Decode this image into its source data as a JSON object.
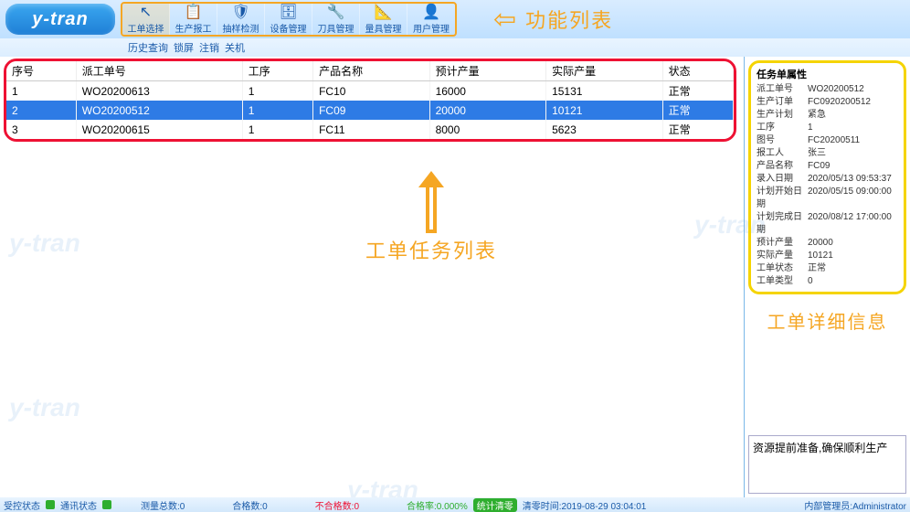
{
  "logo_text": "y-tran",
  "toolbar": [
    {
      "icon": "↖",
      "label": "工单选择"
    },
    {
      "icon": "📋",
      "label": "生产报工"
    },
    {
      "icon": "🛡",
      "label": "抽样检测"
    },
    {
      "icon": "🗄",
      "label": "设备管理"
    },
    {
      "icon": "🔧",
      "label": "刀具管理"
    },
    {
      "icon": "📐",
      "label": "量具管理"
    },
    {
      "icon": "👤",
      "label": "用户管理"
    }
  ],
  "secondary_menu": [
    "历史查询",
    "锁屏",
    "注销",
    "关机"
  ],
  "annotations": {
    "toolbar_label": "功能列表",
    "table_label": "工单任务列表",
    "detail_label": "工单详细信息"
  },
  "table": {
    "headers": [
      "序号",
      "派工单号",
      "工序",
      "产品名称",
      "预计产量",
      "实际产量",
      "状态"
    ],
    "rows": [
      {
        "seq": "1",
        "wo": "WO20200613",
        "op": "1",
        "prod": "FC10",
        "plan": "16000",
        "act": "15131",
        "stat": "正常",
        "selected": false
      },
      {
        "seq": "2",
        "wo": "WO20200512",
        "op": "1",
        "prod": "FC09",
        "plan": "20000",
        "act": "10121",
        "stat": "正常",
        "selected": true
      },
      {
        "seq": "3",
        "wo": "WO20200615",
        "op": "1",
        "prod": "FC11",
        "plan": "8000",
        "act": "5623",
        "stat": "正常",
        "selected": false
      }
    ]
  },
  "detail": {
    "title": "任务单属性",
    "rows": [
      {
        "k": "派工单号",
        "v": "WO20200512"
      },
      {
        "k": "生产订单",
        "v": "FC0920200512"
      },
      {
        "k": "生产计划",
        "v": "紧急"
      },
      {
        "k": "工序",
        "v": "1"
      },
      {
        "k": "图号",
        "v": "FC20200511"
      },
      {
        "k": "报工人",
        "v": "张三"
      },
      {
        "k": "产品名称",
        "v": "FC09"
      },
      {
        "k": "录入日期",
        "v": "2020/05/13 09:53:37"
      },
      {
        "k": "计划开始日期",
        "v": "2020/05/15 09:00:00"
      },
      {
        "k": "计划完成日期",
        "v": "2020/08/12 17:00:00"
      },
      {
        "k": "预计产量",
        "v": "20000"
      },
      {
        "k": "实际产量",
        "v": "10121"
      },
      {
        "k": "工单状态",
        "v": "正常"
      },
      {
        "k": "工单类型",
        "v": "0"
      }
    ]
  },
  "right_note": "资源提前准备,确保顺利生产",
  "status": {
    "recv": "受控状态",
    "comm": "通讯状态",
    "meas_total": "测量总数:0",
    "pass": "合格数:0",
    "fail": "不合格数:0",
    "rate": "合格率:0.000%",
    "clear": "统计清零",
    "zero_time": "清零时间:2019-08-29 03:04:01",
    "admin": "内部管理员:Administrator"
  }
}
